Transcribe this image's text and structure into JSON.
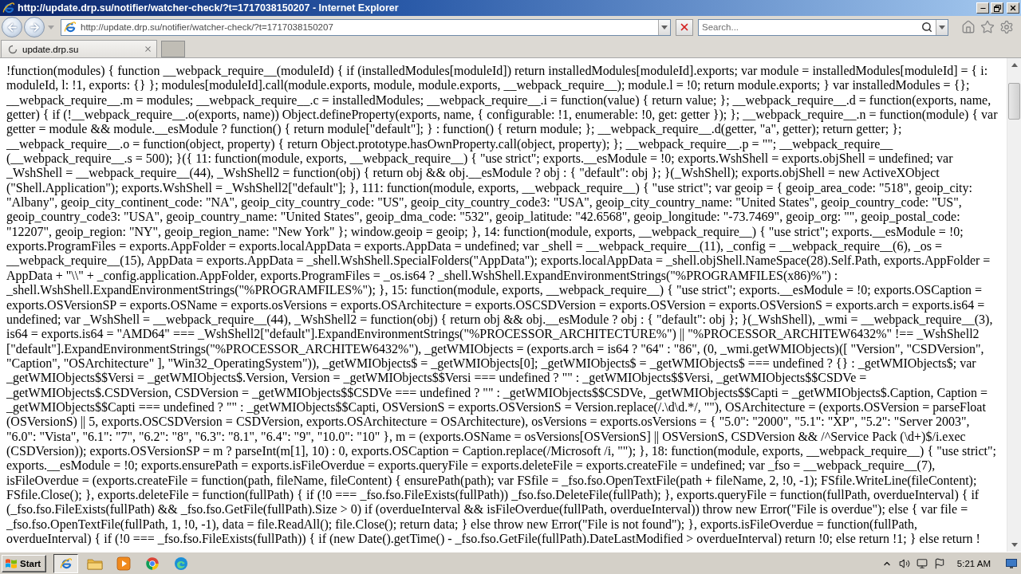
{
  "window": {
    "title": "http://update.drp.su/notifier/watcher-check/?t=1717038150207 - Internet Explorer"
  },
  "address_bar": {
    "url": "http://update.drp.su/notifier/watcher-check/?t=1717038150207"
  },
  "search": {
    "placeholder": "Search..."
  },
  "tabs": [
    {
      "label": "update.drp.su",
      "selected": true
    }
  ],
  "page": {
    "text": "!function(modules) { function __webpack_require__(moduleId) { if (installedModules[moduleId]) return installedModules[moduleId].exports; var module = installedModules[moduleId] = { i: moduleId, l: !1, exports: {} }; modules[moduleId].call(module.exports, module, module.exports, __webpack_require__); module.l = !0; return module.exports; } var installedModules = {}; __webpack_require__.m = modules; __webpack_require__.c = installedModules; __webpack_require__.i = function(value) { return value; }; __webpack_require__.d = function(exports, name, getter) { if (!__webpack_require__.o(exports, name)) Object.defineProperty(exports, name, { configurable: !1, enumerable: !0, get: getter }); }; __webpack_require__.n = function(module) { var getter = module && module.__esModule ? function() { return module[\"default\"]; } : function() { return module; }; __webpack_require__.d(getter, \"a\", getter); return getter; }; __webpack_require__.o = function(object, property) { return Object.prototype.hasOwnProperty.call(object, property); }; __webpack_require__.p = \"\"; __webpack_require__(__webpack_require__.s = 500); }({ 11: function(module, exports, __webpack_require__) { \"use strict\"; exports.__esModule = !0; exports.WshShell = exports.objShell = undefined; var _WshShell = __webpack_require__(44), _WshShell2 = function(obj) { return obj && obj.__esModule ? obj : { \"default\": obj }; }(_WshShell); exports.objShell = new ActiveXObject(\"Shell.Application\"); exports.WshShell = _WshShell2[\"default\"]; }, 111: function(module, exports, __webpack_require__) { \"use strict\"; var geoip = { geoip_area_code: \"518\", geoip_city: \"Albany\", geoip_city_continent_code: \"NA\", geoip_city_country_code: \"US\", geoip_city_country_code3: \"USA\", geoip_city_country_name: \"United States\", geoip_country_code: \"US\", geoip_country_code3: \"USA\", geoip_country_name: \"United States\", geoip_dma_code: \"532\", geoip_latitude: \"42.6568\", geoip_longitude: \"-73.7469\", geoip_org: \"\", geoip_postal_code: \"12207\", geoip_region: \"NY\", geoip_region_name: \"New York\" }; window.geoip = geoip; }, 14: function(module, exports, __webpack_require__) { \"use strict\"; exports.__esModule = !0; exports.ProgramFiles = exports.AppFolder = exports.localAppData = exports.AppData = undefined; var _shell = __webpack_require__(11), _config = __webpack_require__(6), _os = __webpack_require__(15), AppData = exports.AppData = _shell.WshShell.SpecialFolders(\"AppData\"); exports.localAppData = _shell.objShell.NameSpace(28).Self.Path, exports.AppFolder = AppData + \"\\\\\" + _config.application.AppFolder, exports.ProgramFiles = _os.is64 ? _shell.WshShell.ExpandEnvironmentStrings(\"%PROGRAMFILES(x86)%\") : _shell.WshShell.ExpandEnvironmentStrings(\"%PROGRAMFILES%\"); }, 15: function(module, exports, __webpack_require__) { \"use strict\"; exports.__esModule = !0; exports.OSCaption = exports.OSVersionSP = exports.OSName = exports.osVersions = exports.OSArchitecture = exports.OSCSDVersion = exports.OSVersion = exports.OSVersionS = exports.arch = exports.is64 = undefined; var _WshShell = __webpack_require__(44), _WshShell2 = function(obj) { return obj && obj.__esModule ? obj : { \"default\": obj }; }(_WshShell), _wmi = __webpack_require__(3), is64 = exports.is64 = \"AMD64\" === _WshShell2[\"default\"].ExpandEnvironmentStrings(\"%PROCESSOR_ARCHITECTURE%\") || \"%PROCESSOR_ARCHITEW6432%\" !== _WshShell2[\"default\"].ExpandEnvironmentStrings(\"%PROCESSOR_ARCHITEW6432%\"), _getWMIObjects = (exports.arch = is64 ? \"64\" : \"86\", (0, _wmi.getWMIObjects)([ \"Version\", \"CSDVersion\", \"Caption\", \"OSArchitecture\" ], \"Win32_OperatingSystem\")), _getWMIObjects$ = _getWMIObjects[0]; _getWMIObjects$ = _getWMIObjects$ === undefined ? {} : _getWMIObjects$; var _getWMIObjects$$Versi = _getWMIObjects$.Version, Version = _getWMIObjects$$Versi === undefined ? \"\" : _getWMIObjects$$Versi, _getWMIObjects$$CSDVe = _getWMIObjects$.CSDVersion, CSDVersion = _getWMIObjects$$CSDVe === undefined ? \"\" : _getWMIObjects$$CSDVe, _getWMIObjects$$Capti = _getWMIObjects$.Caption, Caption = _getWMIObjects$$Capti === undefined ? \"\" : _getWMIObjects$$Capti, OSVersionS = exports.OSVersionS = Version.replace(/.\\d\\d.*/, \"\"), OSArchitecture = (exports.OSVersion = parseFloat(OSVersionS) || 5, exports.OSCSDVersion = CSDVersion, exports.OSArchitecture = OSArchitecture), osVersions = exports.osVersions = { \"5.0\": \"2000\", \"5.1\": \"XP\", \"5.2\": \"Server 2003\", \"6.0\": \"Vista\", \"6.1\": \"7\", \"6.2\": \"8\", \"6.3\": \"8.1\", \"6.4\": \"9\", \"10.0\": \"10\" }, m = (exports.OSName = osVersions[OSVersionS] || OSVersionS, CSDVersion && /^Service Pack (\\d+)$/i.exec(CSDVersion)); exports.OSVersionSP = m ? parseInt(m[1], 10) : 0, exports.OSCaption = Caption.replace(/Microsoft /i, \"\"); }, 18: function(module, exports, __webpack_require__) { \"use strict\"; exports.__esModule = !0; exports.ensurePath = exports.isFileOverdue = exports.queryFile = exports.deleteFile = exports.createFile = undefined; var _fso = __webpack_require__(7), isFileOverdue = (exports.createFile = function(path, fileName, fileContent) { ensurePath(path); var FSfile = _fso.fso.OpenTextFile(path + fileName, 2, !0, -1); FSfile.WriteLine(fileContent); FSfile.Close(); }, exports.deleteFile = function(fullPath) { if (!0 === _fso.fso.FileExists(fullPath)) _fso.fso.DeleteFile(fullPath); }, exports.queryFile = function(fullPath, overdueInterval) { if (_fso.fso.FileExists(fullPath) && _fso.fso.GetFile(fullPath).Size > 0) if (overdueInterval && isFileOverdue(fullPath, overdueInterval)) throw new Error(\"File is overdue\"); else { var file = _fso.fso.OpenTextFile(fullPath, 1, !0, -1), data = file.ReadAll(); file.Close(); return data; } else throw new Error(\"File is not found\"); }, exports.isFileOverdue = function(fullPath, overdueInterval) { if (!0 === _fso.fso.FileExists(fullPath)) { if (new Date().getTime() - _fso.fso.GetFile(fullPath).DateLastModified > overdueInterval) return !0; else return !1; } else return !"
  },
  "taskbar": {
    "start": "Start",
    "buttons": [
      {
        "kind": "browser-e",
        "active": true
      },
      {
        "kind": "folder",
        "active": false
      },
      {
        "kind": "media-play",
        "active": false
      },
      {
        "kind": "color-wheel",
        "active": false
      },
      {
        "kind": "swirl",
        "active": false
      }
    ],
    "clock": "5:21 AM"
  }
}
